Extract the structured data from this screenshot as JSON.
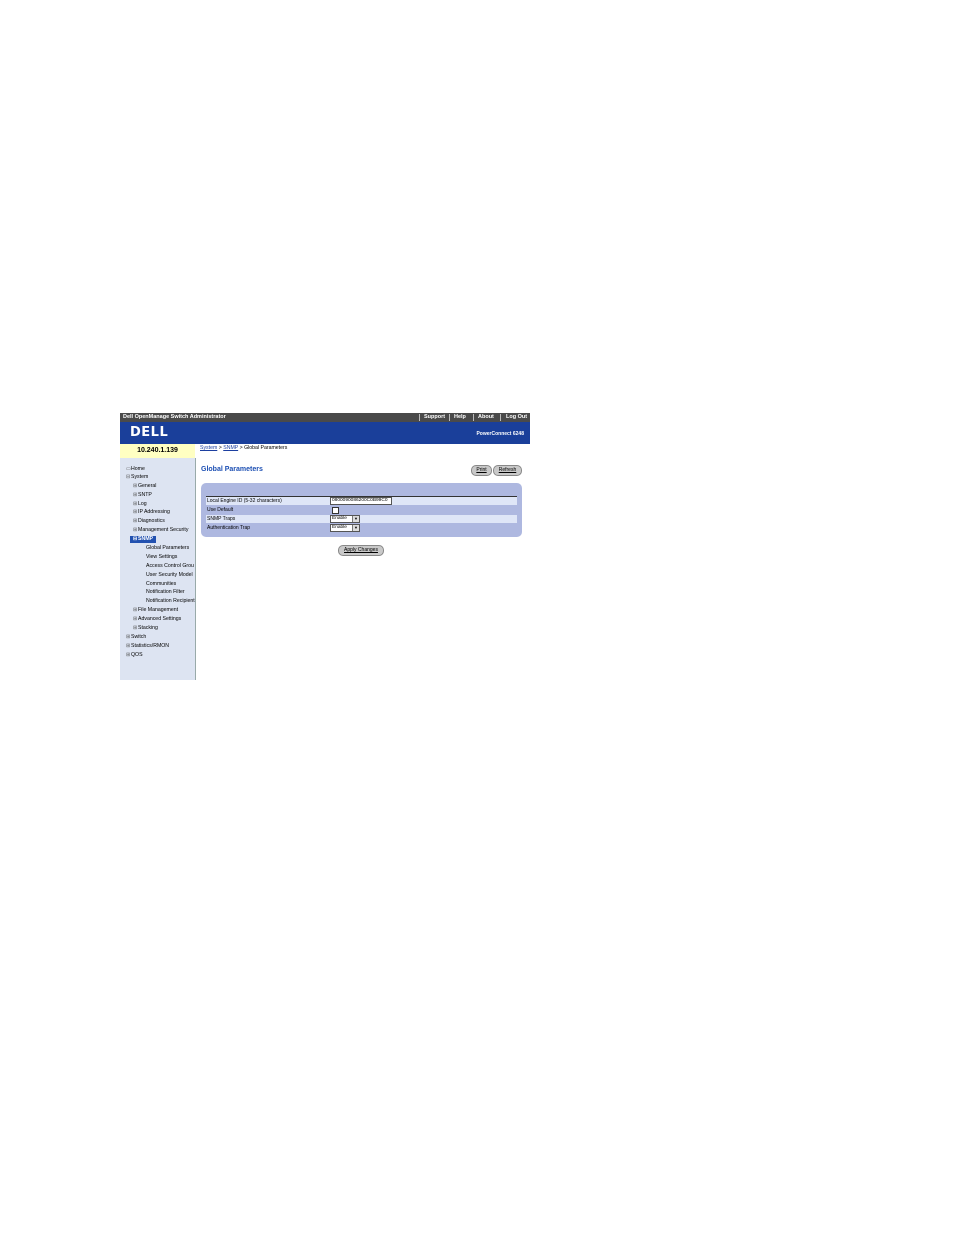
{
  "header": {
    "app_title": "Dell OpenManage Switch Administrator",
    "links": [
      "Support",
      "Help",
      "About",
      "Log Out"
    ],
    "logo": "DELL",
    "product": "PowerConnect 6248"
  },
  "device_ip": "10.240.1.139",
  "sidebar": {
    "home": "Home",
    "system": "System",
    "system_children": [
      "General",
      "SNTP",
      "Log",
      "IP Addressing",
      "Diagnostics",
      "Management Security"
    ],
    "snmp": "SNMP",
    "snmp_children": [
      "Global Parameters",
      "View Settings",
      "Access Control Grou",
      "User Security Model",
      "Communities",
      "Notification Filter",
      "Notification Recipient"
    ],
    "system_after": [
      "File Management",
      "Advanced Settings",
      "Stacking"
    ],
    "top_after": [
      "Switch",
      "Statistics/RMON",
      "QOS"
    ]
  },
  "breadcrumb": {
    "system": "System",
    "snmp": "SNMP",
    "current": "Global Parameters",
    "sep": ">"
  },
  "page_title": "Global Parameters",
  "buttons": {
    "print": "Print",
    "refresh": "Refresh",
    "apply": "Apply Changes"
  },
  "form": {
    "engine_label": "Local Engine ID (5-32 characters)",
    "engine_value": "0800090086200C0B99C0",
    "use_default_label": "Use Default",
    "snmp_traps_label": "SNMP Traps",
    "snmp_traps_value": "Enable",
    "auth_trap_label": "Authentication Trap",
    "auth_trap_value": "Enable"
  },
  "colors": {
    "banner": "#1a3f9a",
    "topbar": "#4a4a4a",
    "panel": "#aeb8e0",
    "title": "#1c4fb3"
  }
}
